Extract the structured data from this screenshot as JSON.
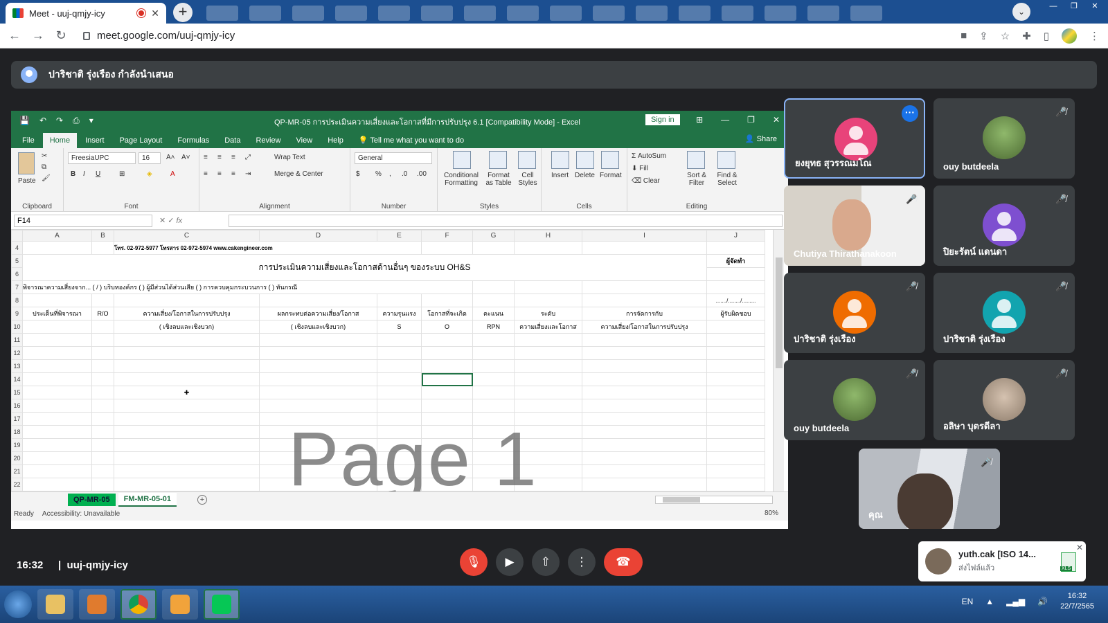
{
  "browser": {
    "tab_title": "Meet - uuj-qmjy-icy",
    "url": "meet.google.com/uuj-qmjy-icy"
  },
  "presenting_banner": "ปาริชาติ รุ่งเรือง กำลังนำเสนอ",
  "excel": {
    "title": "QP-MR-05 การประเมินความเสี่ยงและโอกาสที่มีการปรับปรุง 6.1  [Compatibility Mode]  -  Excel",
    "sign_in": "Sign in",
    "share": "Share",
    "tabs": [
      "File",
      "Home",
      "Insert",
      "Page Layout",
      "Formulas",
      "Data",
      "Review",
      "View",
      "Help"
    ],
    "tell_me": "Tell me what you want to do",
    "ribbon": {
      "paste": "Paste",
      "clipboard": "Clipboard",
      "font_name": "FreesiaUPC",
      "font_size": "16",
      "font": "Font",
      "wrap_text": "Wrap Text",
      "merge_center": "Merge & Center",
      "alignment": "Alignment",
      "number_format": "General",
      "number": "Number",
      "conditional_formatting": "Conditional Formatting",
      "format_as_table": "Format as Table",
      "cell_styles": "Cell Styles",
      "styles": "Styles",
      "insert": "Insert",
      "delete": "Delete",
      "format": "Format",
      "cells": "Cells",
      "autosum": "AutoSum",
      "fill": "Fill",
      "clear": "Clear",
      "sort_filter": "Sort & Filter",
      "find_select": "Find & Select",
      "editing": "Editing"
    },
    "name_box": "F14",
    "fx": "fx",
    "columns": [
      "A",
      "B",
      "C",
      "D",
      "E",
      "F",
      "G",
      "H",
      "I",
      "J"
    ],
    "rows": [
      "4",
      "5",
      "6",
      "7",
      "8",
      "9",
      "10",
      "11",
      "12",
      "13",
      "14",
      "15",
      "16",
      "17",
      "18",
      "19",
      "20",
      "21",
      "22"
    ],
    "cells": {
      "r4_contact": "โทร. 02-972-5977  โทรสาร 02-972-5974  www.cakengineer.com",
      "r5_title": "การประเมินความเสี่ยงและโอกาสด้านอื่นๆ  ของระบบ OH&S",
      "r5_j": "ผู้จัดทำ",
      "r7_text": "พิจารณาความเสี่ยงจาก...  ( / ) บริบทองค์กร     (   ) ผู้มีส่วนได้ส่วนเสีย     (   ) การควบคุมกระบวนการ     (   ) ทันกรณี",
      "r8_j": "......./......../.........",
      "h9": [
        "ประเด็นที่พิจารณา",
        "R/O",
        "ความเสี่ยง/โอกาสในการปรับปรุง",
        "ผลกระทบต่อความเสี่ยง/โอกาส",
        "ความรุนแรง",
        "โอกาสที่จะเกิด",
        "คะแนน",
        "ระดับ",
        "การจัดการกับ",
        "ผู้รับผิดชอบ"
      ],
      "h10": [
        "",
        "",
        "( เชิงลบและเชิงบวก)",
        "( เชิงลบและเชิงบวก)",
        "S",
        "O",
        "RPN",
        "ความเสี่ยงและโอกาส",
        "ความเสี่ยง/โอกาสในการปรับปรุง",
        ""
      ]
    },
    "watermark": "Page 1",
    "sheets": [
      "QP-MR-05",
      "FM-MR-05-01"
    ],
    "status_ready": "Ready",
    "accessibility": "Accessibility: Unavailable",
    "zoom": "80%"
  },
  "participants": [
    {
      "name": "ยงยุทธ สุวรรณมโณ",
      "color": "#e8437a",
      "type": "avatar"
    },
    {
      "name": "ouy butdeela",
      "color": "#6d8b4e",
      "type": "photo"
    },
    {
      "name": "Chutiya Thirathanakoon",
      "color": "#c9c3b8",
      "type": "video"
    },
    {
      "name": "ปิยะรัตน์ แดนดา",
      "color": "#7e4fd0",
      "type": "avatar"
    },
    {
      "name": "ปาริชาติ รุ่งเรือง",
      "color": "#ef6c00",
      "type": "avatar"
    },
    {
      "name": "ปาริชาติ รุ่งเรือง",
      "color": "#12a4af",
      "type": "avatar"
    },
    {
      "name": "ouy butdeela",
      "color": "#6d8b4e",
      "type": "photo"
    },
    {
      "name": "อลิษา บุตรดีลา",
      "color": "#b7a89b",
      "type": "photo"
    },
    {
      "name": "คุณ",
      "color": "#8a8f98",
      "type": "video"
    }
  ],
  "meeting": {
    "time": "16:32",
    "code": "uuj-qmjy-icy"
  },
  "notification": {
    "title": "yuth.cak [ISO 14...",
    "subtitle": "ส่งไฟล์แล้ว",
    "file_type": "XLS"
  },
  "taskbar": {
    "lang": "EN",
    "time": "16:32",
    "date": "22/7/2565"
  }
}
